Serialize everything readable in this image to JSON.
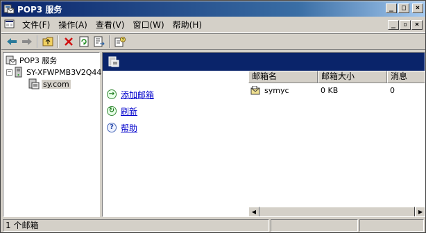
{
  "window": {
    "title": "POP3 服务",
    "caption_buttons": [
      "_",
      "□",
      "×"
    ]
  },
  "menubar": {
    "items": [
      "文件(F)",
      "操作(A)",
      "查看(V)",
      "窗口(W)",
      "帮助(H)"
    ],
    "mdi_buttons": [
      "_",
      "▫",
      "×"
    ]
  },
  "toolbar": {
    "buttons": [
      "back-icon",
      "forward-icon",
      "up-folder-icon",
      "delete-icon",
      "refresh-icon",
      "export-list-icon",
      "properties-help-icon"
    ]
  },
  "tree": {
    "root": "POP3 服务",
    "server": "SY-XFWPMB3V2Q44",
    "domain": "sy.com"
  },
  "tasks": [
    {
      "icon": "add-mailbox-icon",
      "label": "添加邮箱"
    },
    {
      "icon": "refresh-icon",
      "label": "刷新"
    },
    {
      "icon": "help-icon",
      "label": "帮助"
    }
  ],
  "list": {
    "columns": [
      "邮箱名",
      "邮箱大小",
      "消息"
    ],
    "rows": [
      {
        "name": "symyc",
        "size": "0 KB",
        "messages": "0"
      }
    ]
  },
  "status": {
    "text": "1 个邮箱"
  },
  "colors": {
    "title_start": "#0a246a",
    "title_end": "#a6caf0",
    "header_band": "#0a246a",
    "link": "#0000cc",
    "face": "#d4d0c8"
  }
}
